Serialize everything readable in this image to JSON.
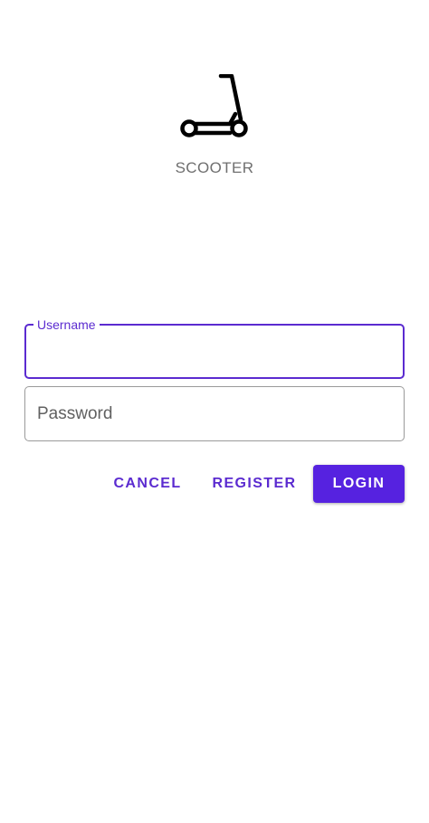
{
  "app": {
    "name": "SCOOTER",
    "logo_icon": "scooter-icon"
  },
  "form": {
    "username": {
      "label": "Username",
      "value": ""
    },
    "password": {
      "placeholder": "Password",
      "value": ""
    }
  },
  "actions": {
    "cancel_label": "CANCEL",
    "register_label": "REGISTER",
    "login_label": "LOGIN"
  },
  "colors": {
    "accent": "#5b2bd0",
    "primary_button": "#5622e0",
    "muted_text": "#6f6f6f"
  }
}
